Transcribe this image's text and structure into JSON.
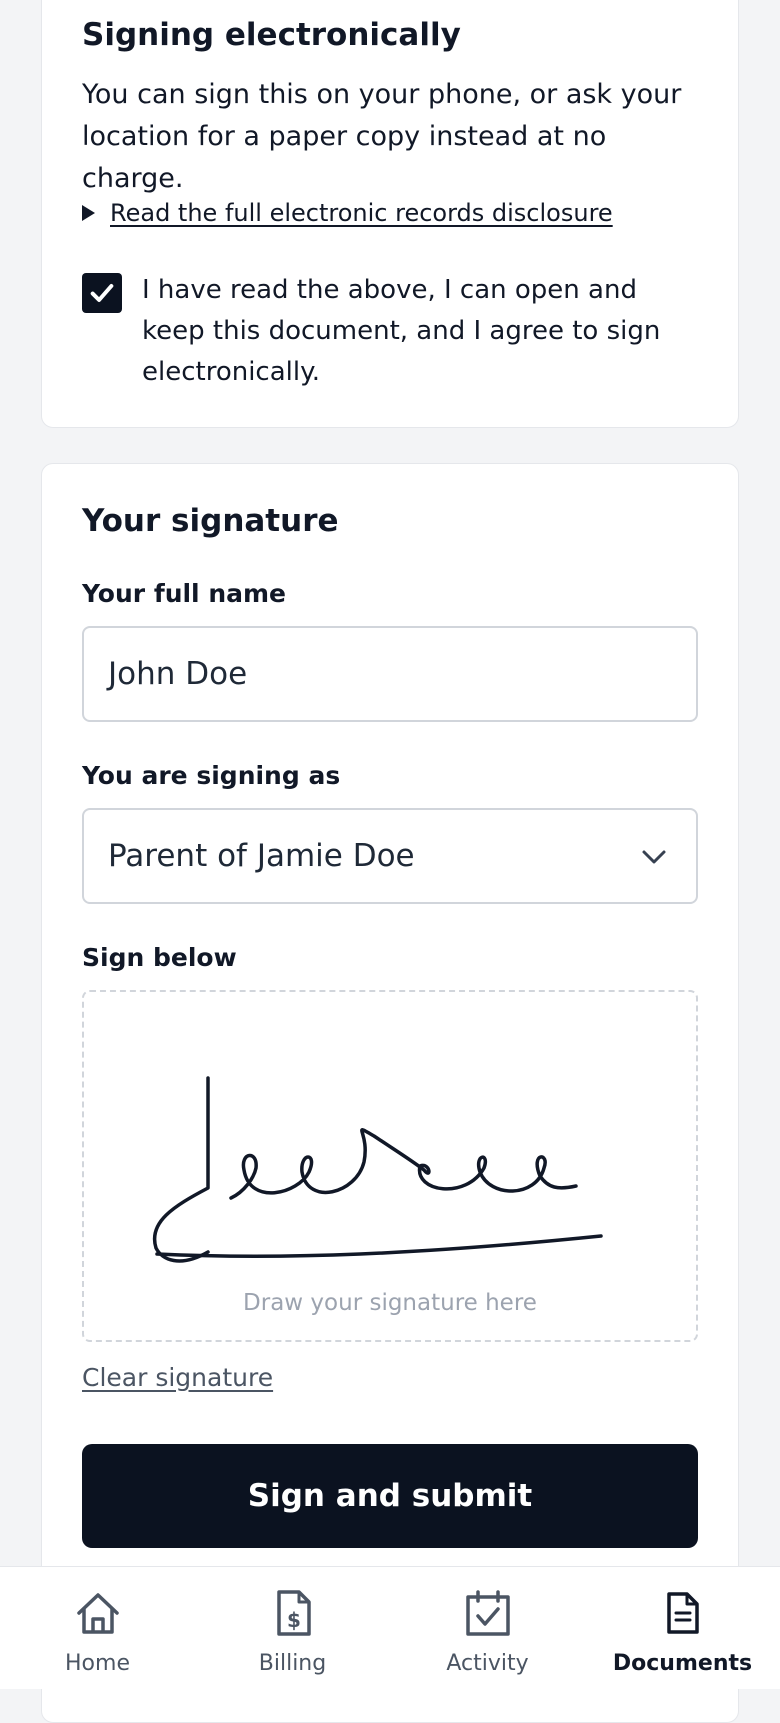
{
  "consent": {
    "heading": "Signing electronically",
    "body": "You can sign this on your phone, or ask your location for a paper copy instead at no charge.",
    "disclosure_link": "Read the full electronic records disclosure",
    "checkbox_checked": true,
    "checkbox_label": "I have read the above, I can open and keep this document, and I agree to sign electronically."
  },
  "signature": {
    "heading": "Your signature",
    "name_label": "Your full name",
    "name_value": "John Doe",
    "role_label": "You are signing as",
    "role_value": "Parent of Jamie Doe",
    "sign_label": "Sign below",
    "pad_hint": "Draw your signature here",
    "clear_label": "Clear signature",
    "submit_label": "Sign and submit"
  },
  "nav": {
    "tabs": [
      {
        "label": "Home",
        "icon": "home-icon",
        "active": false
      },
      {
        "label": "Billing",
        "icon": "billing-icon",
        "active": false
      },
      {
        "label": "Activity",
        "icon": "activity-icon",
        "active": false
      },
      {
        "label": "Documents",
        "icon": "documents-icon",
        "active": true
      }
    ]
  },
  "colors": {
    "primary": "#0b1220",
    "background": "#f3f4f6",
    "muted_text": "#4b5563",
    "placeholder": "#9ca3af"
  }
}
